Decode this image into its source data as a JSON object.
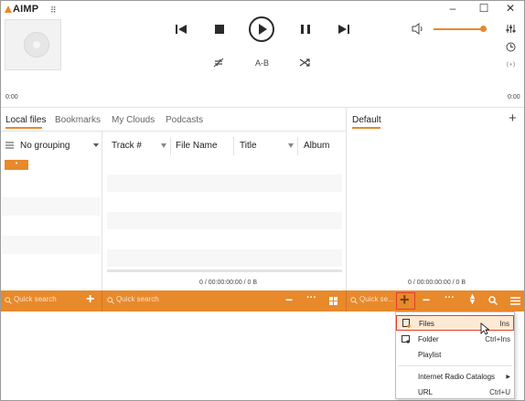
{
  "app": {
    "logo": "AIMP"
  },
  "window": {
    "minimize": "‒",
    "maximize": "☐",
    "close": "✕"
  },
  "transport": {
    "ab_label": "A-B"
  },
  "time": {
    "elapsed": "0:00",
    "total": "0:00"
  },
  "volume": {
    "level_percent": 90
  },
  "library": {
    "tabs": [
      "Local files",
      "Bookmarks",
      "My Clouds",
      "Podcasts"
    ],
    "active_tab": "Local files",
    "grouping": "No grouping",
    "columns": [
      "Track #",
      "File Name",
      "Title",
      "Album"
    ],
    "status": "0 / 00:00:00:00 / 0 B",
    "search_placeholder": "Quick search",
    "search_placeholder_2": "Quick search"
  },
  "playlist": {
    "tab": "Default",
    "add_tab": "+",
    "status": "0 / 00:00:00:00 / 0 B",
    "search_placeholder": "Quick se..."
  },
  "context_menu": {
    "items": [
      {
        "label": "Files",
        "shortcut": "Ins",
        "highlighted": true
      },
      {
        "label": "Folder",
        "shortcut": "Ctrl+Ins"
      },
      {
        "label": "Playlist",
        "shortcut": ""
      },
      {
        "label": "Internet Radio Catalogs",
        "shortcut": "",
        "submenu": true
      },
      {
        "label": "URL",
        "shortcut": "Ctrl+U"
      }
    ]
  },
  "colors": {
    "accent": "#e8892b",
    "highlight_border": "#e0402b"
  }
}
